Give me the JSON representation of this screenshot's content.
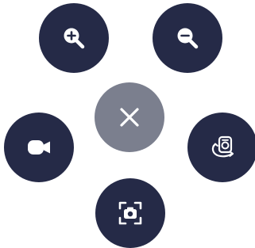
{
  "menu": {
    "buttons": [
      {
        "id": "zoom-in",
        "icon": "zoom-in-icon"
      },
      {
        "id": "zoom-out",
        "icon": "zoom-out-icon"
      },
      {
        "id": "close",
        "icon": "close-icon"
      },
      {
        "id": "video",
        "icon": "video-camera-icon"
      },
      {
        "id": "rotate-camera",
        "icon": "rotate-camera-icon"
      },
      {
        "id": "capture",
        "icon": "screenshot-capture-icon"
      }
    ]
  },
  "colors": {
    "button_dark": "#252a47",
    "button_close": "#7b7f8e",
    "icon": "#ffffff"
  }
}
